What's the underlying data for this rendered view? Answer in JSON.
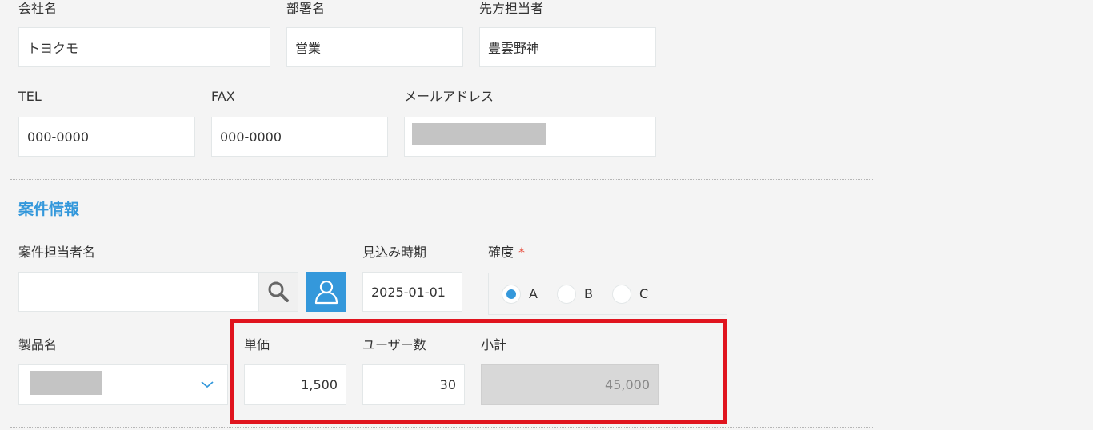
{
  "customer": {
    "company_label": "会社名",
    "company_value": "トヨクモ",
    "department_label": "部署名",
    "department_value": "営業",
    "contact_label": "先方担当者",
    "contact_value": "豊雲野神",
    "tel_label": "TEL",
    "tel_value": "000-0000",
    "fax_label": "FAX",
    "fax_value": "000-0000",
    "email_label": "メールアドレス"
  },
  "project": {
    "section_title": "案件情報",
    "owner_label": "案件担当者名",
    "owner_value": "",
    "expected_label": "見込み時期",
    "expected_value": "2025-01-01",
    "certainty_label": "確度",
    "required_mark": "*",
    "certainty_options": [
      "A",
      "B",
      "C"
    ],
    "certainty_selected": "A"
  },
  "product": {
    "name_label": "製品名",
    "unit_price_label": "単価",
    "unit_price_value": "1,500",
    "users_label": "ユーザー数",
    "users_value": "30",
    "subtotal_label": "小計",
    "subtotal_value": "45,000"
  },
  "colors": {
    "accent": "#3498db",
    "highlight": "#e0141e",
    "required": "#e74c3c"
  }
}
